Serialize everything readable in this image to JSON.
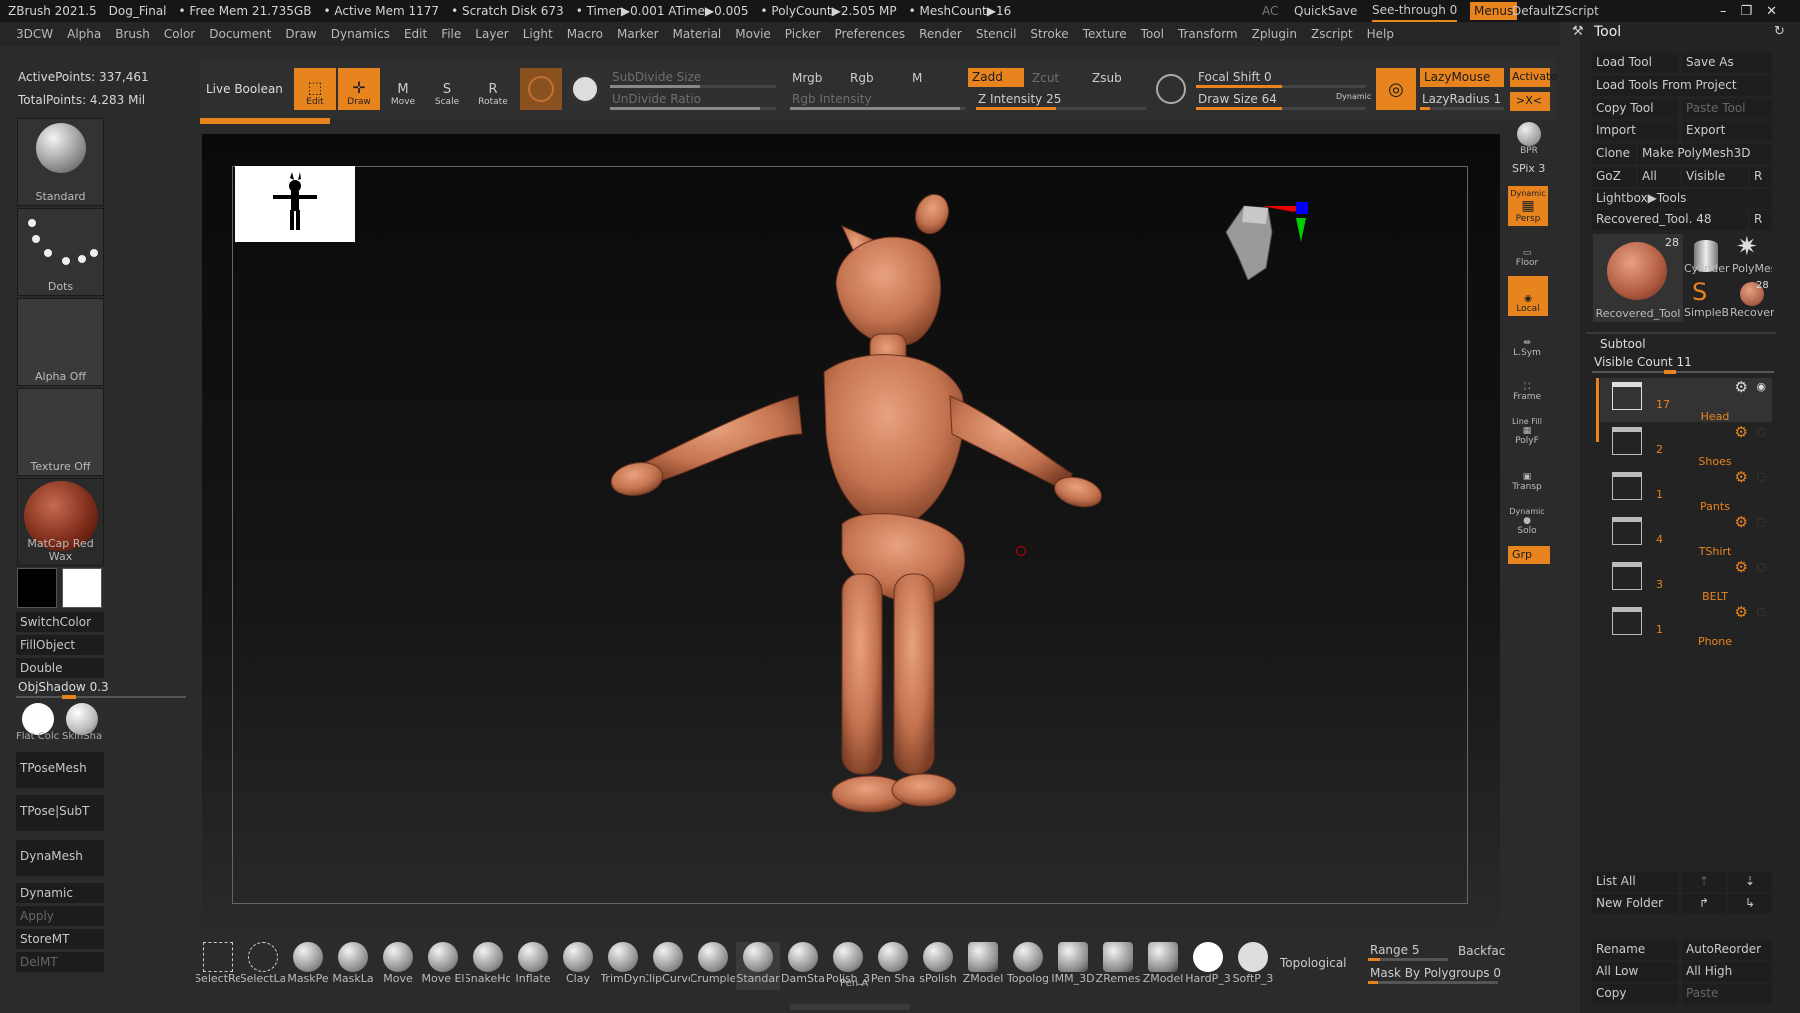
{
  "titlebar": {
    "app": "ZBrush 2021.5",
    "doc": "Dog_Final",
    "free_mem": "• Free Mem 21.735GB",
    "active_mem": "• Active Mem 1177",
    "scratch": "• Scratch Disk 673",
    "timer": "• Timer▶0.001 ATime▶0.005",
    "polycount": "• PolyCount▶2.505 MP",
    "meshcount": "• MeshCount▶16",
    "ac": "AC",
    "quicksave": "QuickSave",
    "seethrough": "See-through  0",
    "menus": "Menus",
    "script": "DefaultZScript"
  },
  "menu": [
    "3DCW",
    "Alpha",
    "Brush",
    "Color",
    "Document",
    "Draw",
    "Dynamics",
    "Edit",
    "File",
    "Layer",
    "Light",
    "Macro",
    "Marker",
    "Material",
    "Movie",
    "Picker",
    "Preferences",
    "Render",
    "Stencil",
    "Stroke",
    "Texture",
    "Tool",
    "Transform",
    "Zplugin",
    "Zscript",
    "Help"
  ],
  "stats": {
    "active_points": "ActivePoints: 337,461",
    "total_points": "TotalPoints: 4.283 Mil"
  },
  "left": {
    "brush": "Standard",
    "stroke": "Dots",
    "alpha": "Alpha Off",
    "texture": "Texture Off",
    "material": "MatCap Red Wax",
    "switchcolor": "SwitchColor",
    "fillobject": "FillObject",
    "double": "Double",
    "objshadow": "ObjShadow",
    "objshadow_val": "0.3",
    "flat": "Flat Colc",
    "skin": "SkinSha",
    "tposemesh": "TPoseMesh",
    "tposesub": "TPose|SubT",
    "dynamesh": "DynaMesh",
    "dynamic": "Dynamic",
    "apply": "Apply",
    "storemt": "StoreMT",
    "delmt": "DelMT"
  },
  "top": {
    "live_boolean": "Live Boolean",
    "edit": "Edit",
    "draw": "Draw",
    "move": "Move",
    "scale": "Scale",
    "rotate": "Rotate",
    "subdiv": "SubDivide Size",
    "undivide": "UnDivide Ratio",
    "mrgb": "Mrgb",
    "rgb": "Rgb",
    "m": "M",
    "rgb_int": "Rgb Intensity",
    "zadd": "Zadd",
    "zcut": "Zcut",
    "zsub": "Zsub",
    "z_int": "Z Intensity 25",
    "focal": "Focal Shift 0",
    "drawsize": "Draw Size 64",
    "dynamic": "Dynamic",
    "lazymouse": "LazyMouse",
    "lazyradius": "LazyRadius 1",
    "activate": "Activate",
    "xc": ">X<"
  },
  "right_shelf": {
    "bpr": "BPR",
    "spix": "SPix 3",
    "persp": "Persp",
    "dynamic": "Dynamic",
    "floor": "Floor",
    "local": "Local",
    "lsym": "L.Sym",
    "frame": "Frame",
    "linefill": "Line Fill",
    "polyf": "PolyF",
    "transp": "Transp",
    "solo": "Solo",
    "dyn2": "Dynamic",
    "grp": "Grp"
  },
  "tool": {
    "title": "Tool",
    "load": "Load Tool",
    "saveas": "Save As",
    "loadproj": "Load Tools From Project",
    "copy": "Copy Tool",
    "paste": "Paste Tool",
    "import": "Import",
    "export": "Export",
    "clone": "Clone",
    "makepm": "Make PolyMesh3D",
    "goz": "GoZ",
    "all": "All",
    "visible": "Visible",
    "r": "R",
    "lightbox": "Lightbox▶Tools",
    "recovered": "Recovered_Tool. 48",
    "r2": "R",
    "thumb_count": "28",
    "thumb_name": "Recovered_Tool",
    "cyl": "Cylinder",
    "polym": "PolyMes",
    "simpleb": "SimpleB",
    "recov": "Recover",
    "small_count": "28",
    "subtool": "Subtool",
    "visible_count": "Visible Count 11",
    "listall": "List All",
    "newfolder": "New Folder",
    "rename": "Rename",
    "autoreorder": "AutoReorder",
    "alllow": "All Low",
    "allhigh": "All High",
    "copy2": "Copy",
    "paste2": "Paste"
  },
  "subtools": [
    {
      "count": "17",
      "name": "Head"
    },
    {
      "count": "2",
      "name": "Shoes"
    },
    {
      "count": "1",
      "name": "Pants"
    },
    {
      "count": "4",
      "name": "TShirt"
    },
    {
      "count": "3",
      "name": "BELT"
    },
    {
      "count": "1",
      "name": "Phone"
    }
  ],
  "brushes": [
    "SelectRe",
    "SelectLa",
    "MaskPe",
    "MaskLa",
    "Move",
    "Move El",
    "SnakeHo",
    "Inflate",
    "Clay",
    "TrimDyn",
    "ClipCurve",
    "Crumple",
    "Standar",
    "DamSta",
    "Polish_3",
    "Pen Sha",
    "sPolish",
    "ZModel",
    "Topolog",
    "IMM_3D",
    "ZRemes",
    "ZModel",
    "HardP_3",
    "SoftP_3"
  ],
  "bottom": {
    "topological": "Topological",
    "range": "Range 5",
    "backface": "Backfac",
    "mask_pg": "Mask By Polygroups 0",
    "pen_a": "Pen A"
  }
}
